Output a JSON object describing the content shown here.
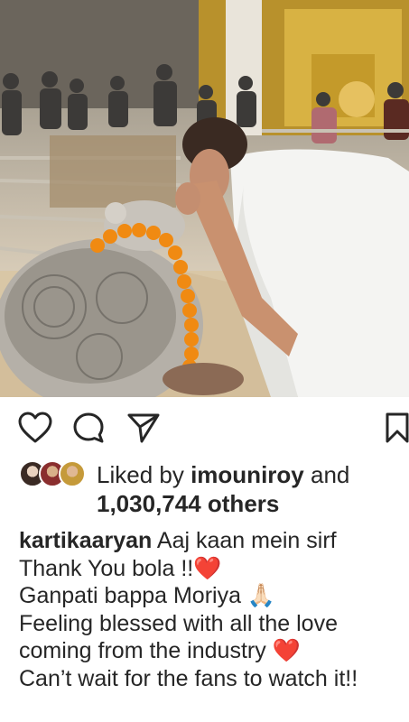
{
  "post": {
    "image_alt": "Man in white shirt bowing before a silver mouse idol with marigold garland in a temple",
    "liked_by_prefix": "Liked by",
    "liked_by_user": "imouniroy",
    "liked_by_and": "and",
    "others_count": "1,030,744 others",
    "caption": {
      "username": "kartikaaryan",
      "lines": [
        "Aaj kaan mein sirf",
        "Thank You bola !!❤️",
        "Ganpati bappa Moriya 🙏🏻",
        "Feeling blessed with all the love",
        "coming from the industry ❤️",
        "Can’t wait for the fans to watch it!!"
      ]
    }
  },
  "icons": {
    "like": "heart-icon",
    "comment": "comment-icon",
    "share": "share-icon",
    "save": "bookmark-icon"
  },
  "colors": {
    "text": "#262626",
    "heart": "#e0245e"
  }
}
